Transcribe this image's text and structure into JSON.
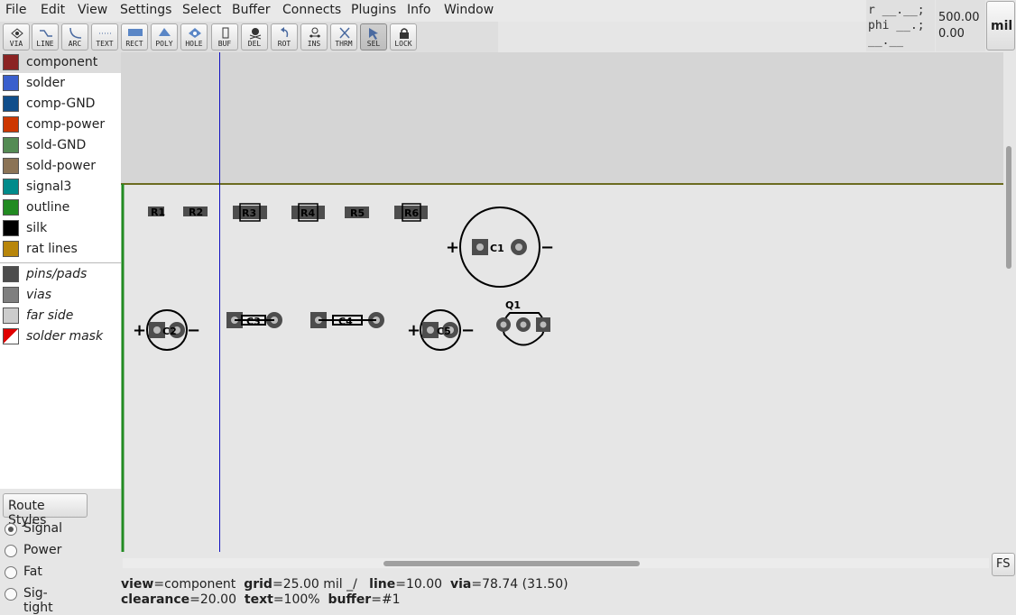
{
  "menubar": {
    "items": [
      "File",
      "Edit",
      "View",
      "Settings",
      "Select",
      "Buffer",
      "Connects",
      "Plugins",
      "Info",
      "Window"
    ]
  },
  "toolbar": {
    "tools": [
      {
        "label": "VIA",
        "icon": "via-icon"
      },
      {
        "label": "LINE",
        "icon": "line-icon"
      },
      {
        "label": "ARC",
        "icon": "arc-icon"
      },
      {
        "label": "TEXT",
        "icon": "text-icon"
      },
      {
        "label": "RECT",
        "icon": "rect-icon"
      },
      {
        "label": "POLY",
        "icon": "poly-icon"
      },
      {
        "label": "HOLE",
        "icon": "hole-icon"
      },
      {
        "label": "BUF",
        "icon": "buffer-icon"
      },
      {
        "label": "DEL",
        "icon": "delete-icon"
      },
      {
        "label": "ROT",
        "icon": "rotate-icon"
      },
      {
        "label": "INS",
        "icon": "insert-icon"
      },
      {
        "label": "THRM",
        "icon": "thermal-icon"
      },
      {
        "label": "SEL",
        "icon": "select-arrow-icon"
      },
      {
        "label": "LOCK",
        "icon": "lock-icon"
      }
    ],
    "active": "SEL"
  },
  "coords": {
    "line1": "r __.__;",
    "line2": "phi __.;",
    "line3": "__.__ __.__"
  },
  "position": {
    "x": "500.00",
    "y": "0.00"
  },
  "unit_button": "mil",
  "layers": [
    {
      "label": "component",
      "color": "#8b2323",
      "selected": true
    },
    {
      "label": "solder",
      "color": "#3a5fcd"
    },
    {
      "label": "comp-GND",
      "color": "#104e8b"
    },
    {
      "label": "comp-power",
      "color": "#cd3700"
    },
    {
      "label": "sold-GND",
      "color": "#548b54"
    },
    {
      "label": "sold-power",
      "color": "#8b7355"
    },
    {
      "label": "signal3",
      "color": "#008b8b"
    },
    {
      "label": "outline",
      "color": "#228b22"
    },
    {
      "label": "silk",
      "color": "#000000"
    },
    {
      "label": "rat lines",
      "color": "#b8860b"
    }
  ],
  "special_layers": [
    {
      "label": "pins/pads",
      "color": "#4d4d4d"
    },
    {
      "label": "vias",
      "color": "#7f7f7f"
    },
    {
      "label": "far side",
      "color": "#cccccc"
    },
    {
      "label": "solder mask",
      "color": "mask"
    }
  ],
  "route": {
    "button_label": "Route Styles",
    "styles": [
      {
        "label": "Signal",
        "selected": true
      },
      {
        "label": "Power"
      },
      {
        "label": "Fat"
      },
      {
        "label": "Sig-tight"
      }
    ]
  },
  "board": {
    "components": [
      {
        "type": "smd",
        "label": "R1"
      },
      {
        "type": "smd",
        "label": "R2"
      },
      {
        "type": "smd",
        "label": "R3"
      },
      {
        "type": "smd",
        "label": "R4"
      },
      {
        "type": "smd",
        "label": "R5"
      },
      {
        "type": "smd",
        "label": "R6"
      },
      {
        "type": "cap",
        "label": "C1"
      },
      {
        "type": "cap",
        "label": "C2"
      },
      {
        "type": "axial",
        "label": "C3"
      },
      {
        "type": "axial",
        "label": "C4"
      },
      {
        "type": "cap",
        "label": "C5"
      },
      {
        "type": "transistor",
        "label": "Q1"
      }
    ],
    "plus_sign": "+",
    "minus_sign": "−"
  },
  "fs_button": "FS",
  "status": {
    "row1": [
      {
        "k": "view",
        "v": "component"
      },
      {
        "k": "grid",
        "v": "25.00 mil  _/"
      },
      {
        "k": "line",
        "v": "10.00"
      },
      {
        "k": "via",
        "v": "78.74 (31.50)"
      }
    ],
    "row2": [
      {
        "k": "clearance",
        "v": "20.00"
      },
      {
        "k": "text",
        "v": "100%"
      },
      {
        "k": "buffer",
        "v": "#1"
      }
    ]
  }
}
